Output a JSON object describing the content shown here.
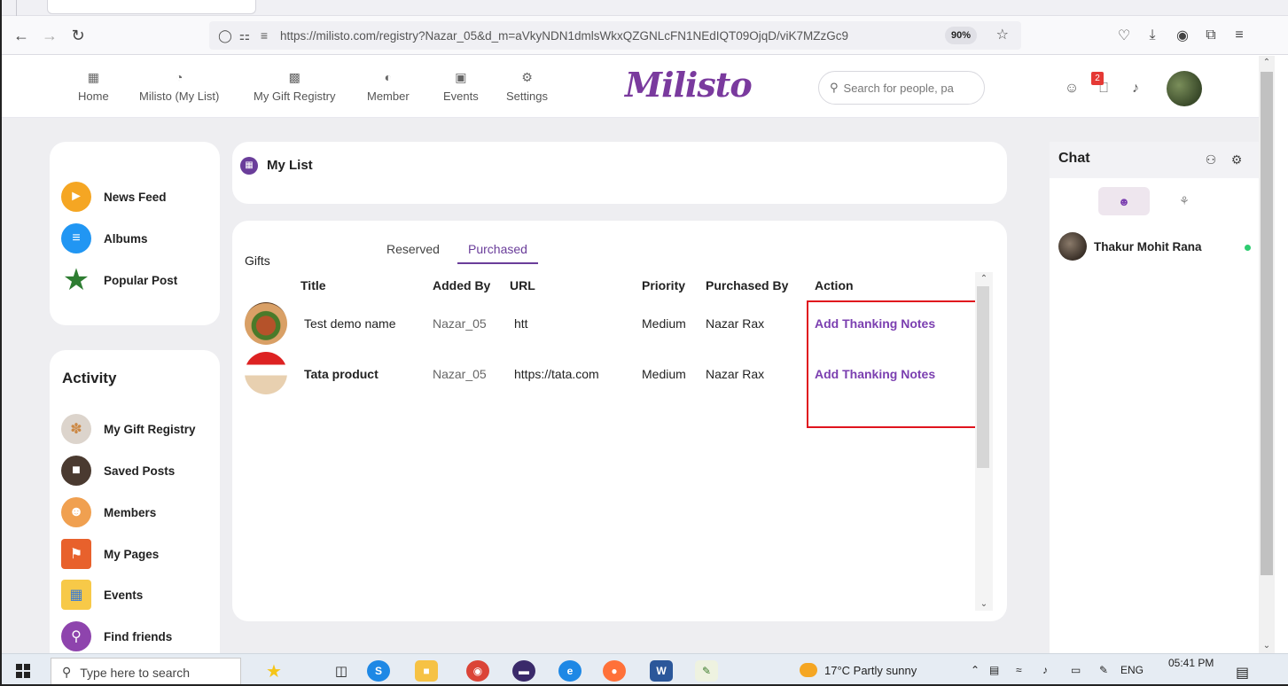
{
  "browser": {
    "url": "https://milisto.com/registry?Nazar_05&d_m=aVkyNDN1dmlsWkxQZGNLcFN1NEdIQT09OjqD/viK7MZzGc9",
    "zoom": "90%"
  },
  "header": {
    "nav": [
      {
        "label": "Home",
        "icon": "grid-icon"
      },
      {
        "label": "Milisto (My List)",
        "icon": "chart-icon"
      },
      {
        "label": "My Gift Registry",
        "icon": "registry-icon"
      },
      {
        "label": "Member",
        "icon": "member-icon"
      },
      {
        "label": "Events",
        "icon": "calendar-icon"
      },
      {
        "label": "Settings",
        "icon": "gear-icon"
      }
    ],
    "logo": "Milisto",
    "search_placeholder": "Search for people, pa",
    "notification_count": "2"
  },
  "sidebar": {
    "top_items": [
      {
        "label": "News Feed",
        "icon": "megaphone-icon",
        "color": "#f5a623"
      },
      {
        "label": "Albums",
        "icon": "albums-icon",
        "color": "#2196f3"
      },
      {
        "label": "Popular Post",
        "icon": "star-icon",
        "color": "#2e7d32"
      }
    ],
    "activity_title": "Activity",
    "activity_items": [
      {
        "label": "My Gift Registry",
        "icon": "gift-icon",
        "color": "#dcd4cc"
      },
      {
        "label": "Saved Posts",
        "icon": "saved-icon",
        "color": "#4a3a30"
      },
      {
        "label": "Members",
        "icon": "members-icon",
        "color": "#f0a050"
      },
      {
        "label": "My Pages",
        "icon": "pages-icon",
        "color": "#e8612c"
      },
      {
        "label": "Events",
        "icon": "events-icon",
        "color": "#f7c948"
      },
      {
        "label": "Find friends",
        "icon": "find-friends-icon",
        "color": "#8e44ad"
      }
    ]
  },
  "main": {
    "section_title": "My List",
    "gifts_label": "Gifts",
    "tabs": [
      {
        "label": "Reserved",
        "active": false
      },
      {
        "label": "Purchased",
        "active": true
      }
    ],
    "columns": [
      "Title",
      "Added By",
      "URL",
      "Priority",
      "Purchased By",
      "Action"
    ],
    "rows": [
      {
        "title": "Test demo name",
        "added_by": "Nazar_05",
        "url": "htt",
        "priority": "Medium",
        "purchased_by": "Nazar Rax",
        "action": "Add Thanking Notes"
      },
      {
        "title": "Tata product",
        "added_by": "Nazar_05",
        "url": "https://tata.com",
        "priority": "Medium",
        "purchased_by": "Nazar Rax",
        "action": "Add Thanking Notes"
      }
    ]
  },
  "chat": {
    "title": "Chat",
    "contacts": [
      {
        "name": "Thakur Mohit Rana",
        "online": true
      }
    ]
  },
  "taskbar": {
    "search_placeholder": "Type here to search",
    "weather": "17°C  Partly sunny",
    "lang": "ENG",
    "time": "05:41 PM"
  },
  "colors": {
    "accent": "#6a3d9a",
    "action_link": "#7b3fb0",
    "highlight": "#e0141e",
    "online": "#2ecc71"
  }
}
